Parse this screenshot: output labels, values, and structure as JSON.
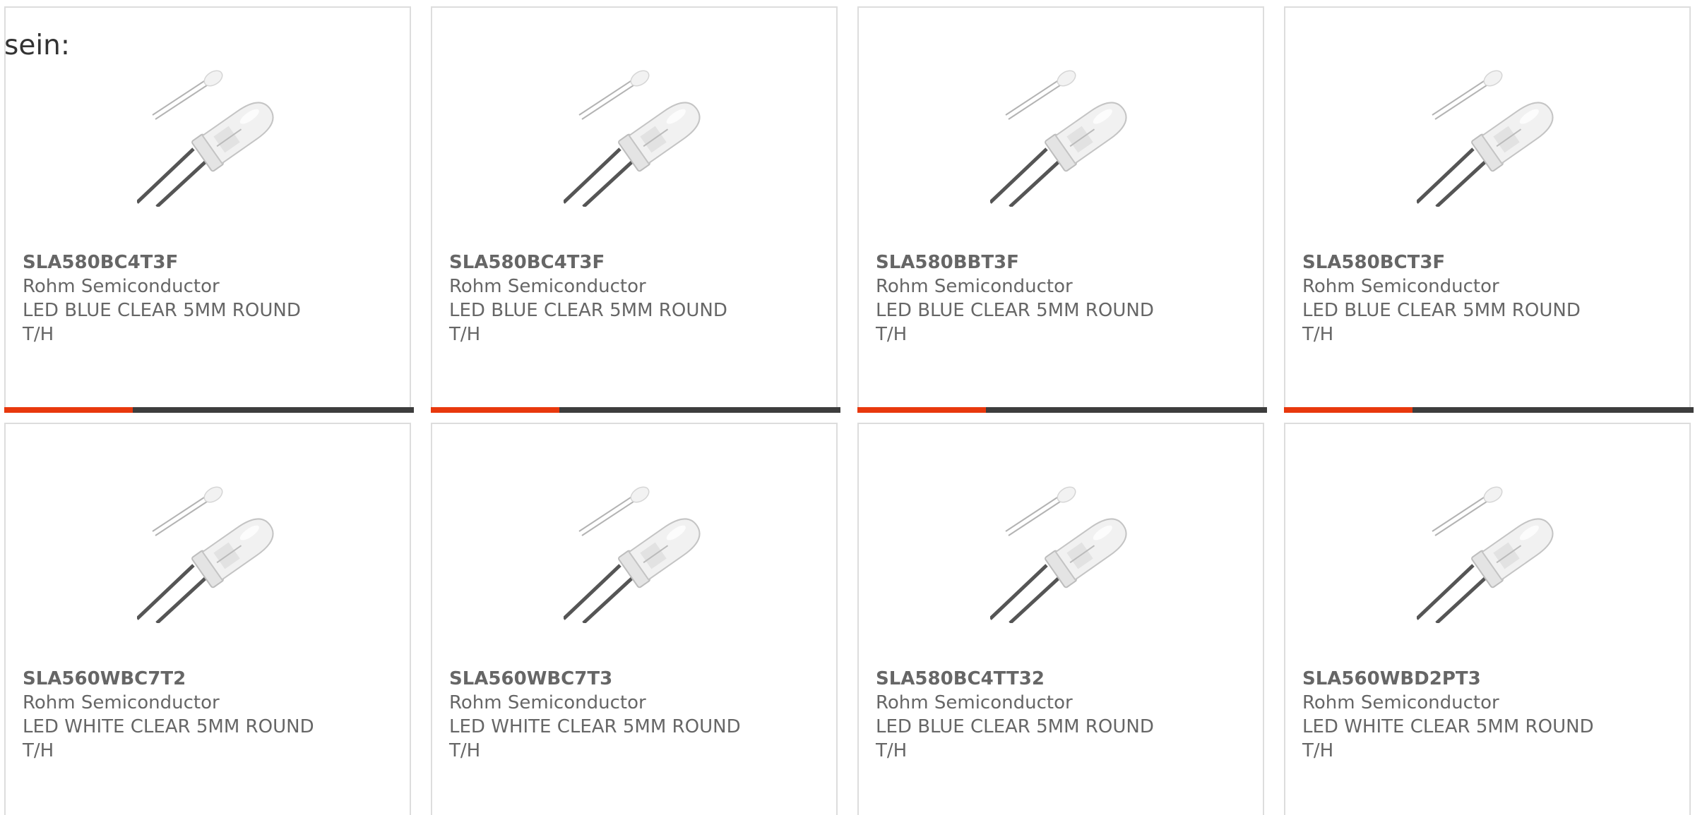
{
  "intro_text": "sein:",
  "colors": {
    "accent": "#e8380d",
    "bar": "#3d3d3d",
    "card_border": "#dddddd",
    "text": "#666666"
  },
  "product_image_icon": "led-5mm-clear-image",
  "cards": [
    {
      "part_number": "SLA580BC4T3F",
      "manufacturer": "Rohm Semiconductor",
      "description": "LED BLUE CLEAR 5MM ROUND T/H",
      "accent_bar": true
    },
    {
      "part_number": "SLA580BC4T3F",
      "manufacturer": "Rohm Semiconductor",
      "description": "LED BLUE CLEAR 5MM ROUND T/H",
      "accent_bar": true
    },
    {
      "part_number": "SLA580BBT3F",
      "manufacturer": "Rohm Semiconductor",
      "description": "LED BLUE CLEAR 5MM ROUND T/H",
      "accent_bar": true
    },
    {
      "part_number": "SLA580BCT3F",
      "manufacturer": "Rohm Semiconductor",
      "description": "LED BLUE CLEAR 5MM ROUND T/H",
      "accent_bar": true
    },
    {
      "part_number": "SLA560WBC7T2",
      "manufacturer": "Rohm Semiconductor",
      "description": "LED WHITE CLEAR 5MM ROUND T/H",
      "accent_bar": false
    },
    {
      "part_number": "SLA560WBC7T3",
      "manufacturer": "Rohm Semiconductor",
      "description": "LED WHITE CLEAR 5MM ROUND T/H",
      "accent_bar": false
    },
    {
      "part_number": "SLA580BC4TT32",
      "manufacturer": "Rohm Semiconductor",
      "description": "LED BLUE CLEAR 5MM ROUND T/H",
      "accent_bar": false
    },
    {
      "part_number": "SLA560WBD2PT3",
      "manufacturer": "Rohm Semiconductor",
      "description": "LED WHITE CLEAR 5MM ROUND T/H",
      "accent_bar": false
    }
  ]
}
